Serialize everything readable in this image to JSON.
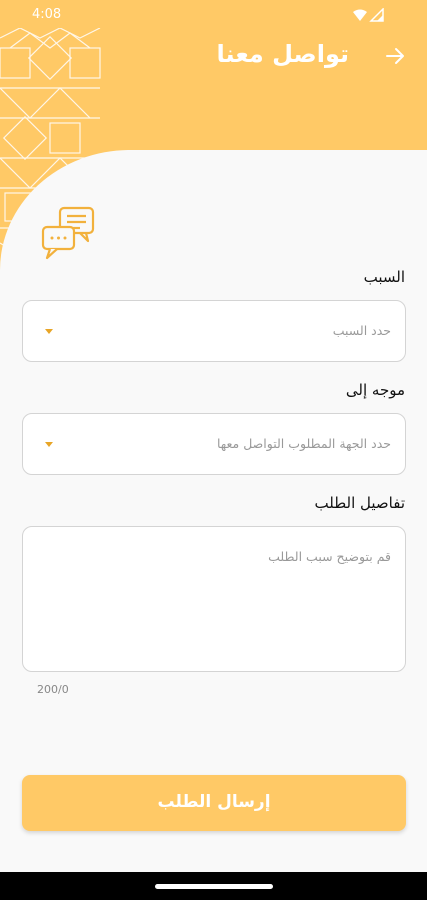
{
  "status_bar": {
    "time": "4:08"
  },
  "header": {
    "title": "تواصل معنا",
    "back_icon": "arrow-right-icon"
  },
  "form": {
    "reason": {
      "label": "السبب",
      "placeholder": "حدد السبب"
    },
    "directed_to": {
      "label": "موجه إلى",
      "placeholder": "حدد الجهة المطلوب التواصل معها"
    },
    "details": {
      "label": "تفاصيل الطلب",
      "placeholder": "قم بتوضيح سبب الطلب",
      "counter": "200/0"
    },
    "submit_label": "إرسال الطلب"
  },
  "colors": {
    "accent": "#ffc966",
    "caret": "#e8a527"
  }
}
